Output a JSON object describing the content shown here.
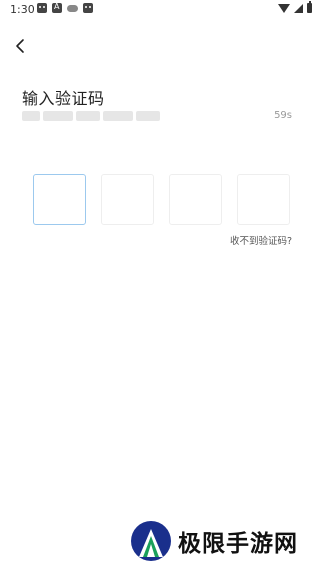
{
  "status_bar": {
    "time": "1:30",
    "notification_icons": [
      "cat-icon",
      "a-icon",
      "game-icon",
      "cat-icon"
    ],
    "right_icons": [
      "wifi-icon",
      "signal-icon",
      "battery-icon"
    ]
  },
  "header": {
    "back_icon": "chevron-left-icon"
  },
  "main": {
    "title": "输入验证码",
    "phone_masked": "",
    "countdown": "59s",
    "code_boxes": [
      "",
      "",
      "",
      ""
    ],
    "resend_link": "收不到验证码?"
  },
  "watermark": {
    "text": "极限手游网",
    "logo": "triangle-logo",
    "colors": {
      "outer": "#1a2f8c",
      "inner": "#1aa05a",
      "text": "#111111"
    }
  },
  "colors": {
    "background": "#ffffff",
    "active_border": "#9cc9ee",
    "box_border": "#eeeeee",
    "muted_text": "#999999"
  }
}
